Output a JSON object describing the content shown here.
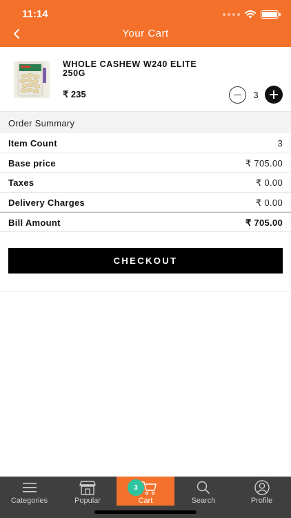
{
  "status_bar": {
    "time": "11:14"
  },
  "header": {
    "title": "Your Cart"
  },
  "cart_item": {
    "name": "WHOLE CASHEW W240 ELITE 250G",
    "price": "₹ 235",
    "quantity": "3"
  },
  "summary": {
    "heading": "Order Summary",
    "rows": [
      {
        "label": "Item Count",
        "value": "3"
      },
      {
        "label": "Base price",
        "value": "₹ 705.00"
      },
      {
        "label": "Taxes",
        "value": "₹ 0.00"
      },
      {
        "label": "Delivery Charges",
        "value": "₹ 0.00"
      }
    ],
    "total": {
      "label": "Bill Amount",
      "value": "₹ 705.00"
    }
  },
  "checkout": {
    "label": "CHECKOUT"
  },
  "tabs": [
    {
      "label": "Categories",
      "icon": "menu-icon"
    },
    {
      "label": "Popular",
      "icon": "store-icon"
    },
    {
      "label": "Cart",
      "icon": "cart-icon",
      "badge": "3",
      "active": true
    },
    {
      "label": "Search",
      "icon": "search-icon"
    },
    {
      "label": "Profile",
      "icon": "profile-icon"
    }
  ],
  "colors": {
    "accent": "#f4712b",
    "tabbar": "#3f3f3f",
    "badge": "#2ec4a0",
    "button": "#000000"
  }
}
